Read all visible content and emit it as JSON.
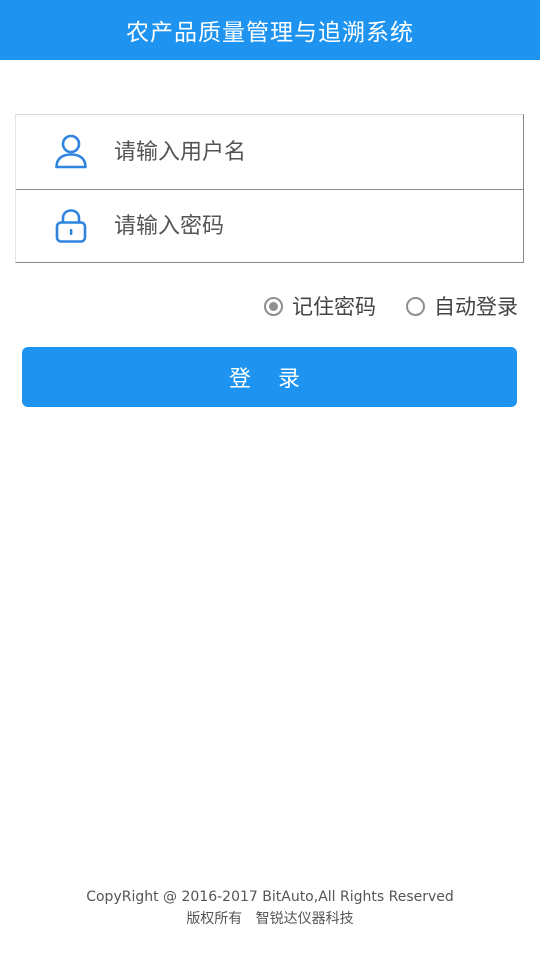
{
  "header": {
    "title": "农产品质量管理与追溯系统",
    "background_color": "#1e94f0"
  },
  "form": {
    "username": {
      "icon": "user-icon",
      "placeholder": "请输入用户名",
      "value": ""
    },
    "password": {
      "icon": "lock-icon",
      "placeholder": "请输入密码",
      "value": ""
    }
  },
  "options": {
    "remember_password": {
      "label": "记住密码",
      "checked": true
    },
    "auto_login": {
      "label": "自动登录",
      "checked": false
    }
  },
  "login_button": {
    "label": "登 录",
    "color": "#1e94f0"
  },
  "footer": {
    "copyright": "CopyRight @ 2016-2017 BitAuto,All Rights Reserved",
    "company": "版权所有   智锐达仪器科技"
  }
}
